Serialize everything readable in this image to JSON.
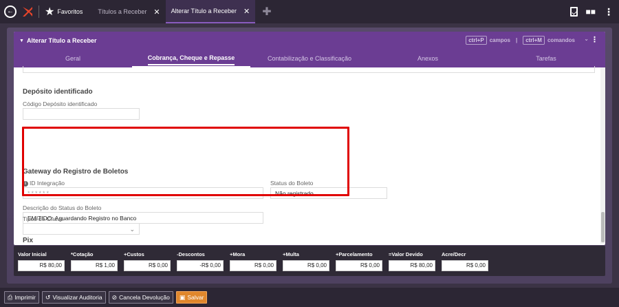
{
  "topbar": {
    "favorites_label": "Favoritos",
    "tabs": [
      {
        "label": "Títulos a Receber",
        "active": false
      },
      {
        "label": "Alterar Título a Receber",
        "active": true
      }
    ]
  },
  "panel": {
    "title": "Alterar Título a Receber",
    "shortcut_fields_key": "ctrl+P",
    "shortcut_fields_label": "campos",
    "shortcut_commands_key": "ctrl+M",
    "shortcut_commands_label": "comandos",
    "tabs": [
      {
        "label": "Geral",
        "active": false
      },
      {
        "label": "Cobrança, Cheque e Repasse",
        "active": true
      },
      {
        "label": "Contabilização e Classificação",
        "active": false
      },
      {
        "label": "Anexos",
        "active": false
      },
      {
        "label": "Tarefas",
        "active": false
      }
    ]
  },
  "deposito": {
    "title": "Depósito identificado",
    "codigo_label": "Código Depósito identificado",
    "codigo_value": ""
  },
  "gateway": {
    "title": "Gateway do Registro de Boletos",
    "id_label": "ID Integração",
    "id_value": "******",
    "status_label": "Status do Boleto",
    "status_value": "Não registrado",
    "descricao_label": "Descrição do Status do Boleto",
    "descricao_value": "EMITIDO: Aguardando Registro no Banco"
  },
  "pix": {
    "title": "Pix",
    "tipos_label": "Tipos de Chave",
    "tipos_value": ""
  },
  "totals": [
    {
      "label": "Valor Inicial",
      "value": "R$ 80,00"
    },
    {
      "label": "*Cotação",
      "value": "R$ 1,00"
    },
    {
      "label": "+Custos",
      "value": "R$ 0,00"
    },
    {
      "label": "-Descontos",
      "value": "-R$ 0,00"
    },
    {
      "label": "+Mora",
      "value": "R$ 0,00"
    },
    {
      "label": "+Multa",
      "value": "R$ 0,00"
    },
    {
      "label": "+Parcelamento",
      "value": "R$ 0,00"
    },
    {
      "label": "=Valor Devido",
      "value": "R$ 80,00"
    },
    {
      "label": "Acre/Decr",
      "value": "R$ 0,00"
    }
  ],
  "bottombar": {
    "print_label": "Imprimir",
    "audit_label": "Visualizar Auditoria",
    "cancel_label": "Cancela Devolução",
    "save_label": "Salvar"
  },
  "colors": {
    "accent": "#6b3d93",
    "highlight": "#e00000",
    "save": "#e0872c"
  }
}
